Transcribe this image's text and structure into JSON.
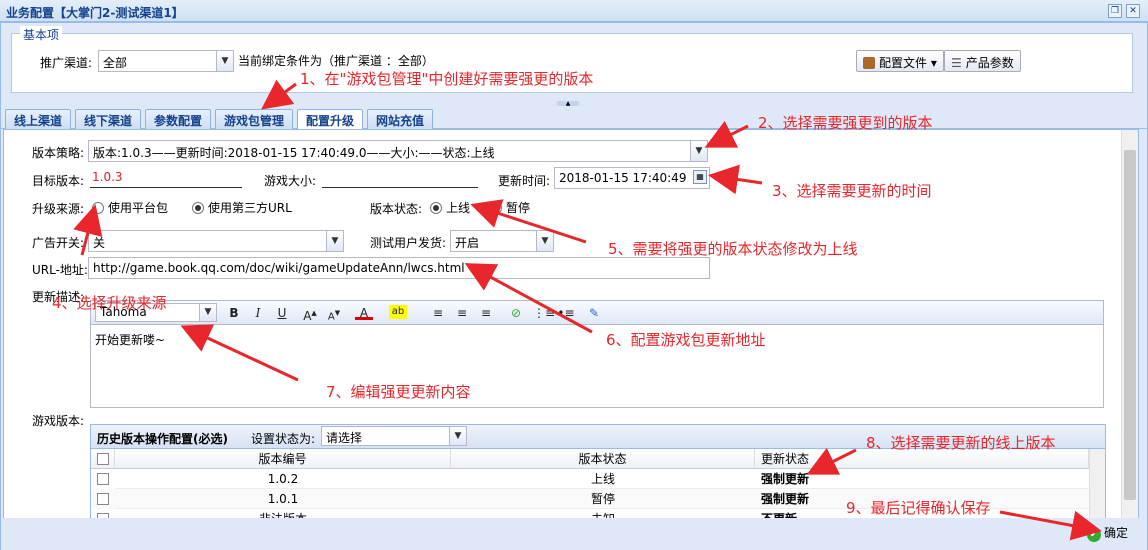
{
  "window": {
    "title": "业务配置【大掌门2-测试渠道1】"
  },
  "basic": {
    "legend": "基本项",
    "channel_label": "推广渠道:",
    "channel_value": "全部",
    "binding_text": "当前绑定条件为（推广渠道 ：全部）",
    "config_file_btn": "配置文件",
    "product_params_btn": "产品参数"
  },
  "tabs": [
    "线上渠道",
    "线下渠道",
    "参数配置",
    "游戏包管理",
    "配置升级",
    "网站充值"
  ],
  "form": {
    "strategy_label": "版本策略:",
    "strategy_value": "版本:1.0.3——更新时间:2018-01-15 17:40:49.0——大小:——状态:上线",
    "target_label": "目标版本:",
    "target_value": "1.0.3",
    "size_label": "游戏大小:",
    "size_value": "",
    "update_time_label": "更新时间:",
    "update_time_value": "2018-01-15 17:40:49",
    "source_label": "升级来源:",
    "source_opt1": "使用平台包",
    "source_opt2": "使用第三方URL",
    "status_label": "版本状态:",
    "status_opt1": "上线",
    "status_opt2": "暂停",
    "ad_label": "广告开关:",
    "ad_value": "关",
    "test_label": "测试用户发货:",
    "test_value": "开启",
    "url_label": "URL-地址:",
    "url_value": "http://game.book.qq.com/doc/wiki/gameUpdateAnn/lwcs.html",
    "desc_label": "更新描述:",
    "font_value": "Tahoma",
    "desc_text": "开始更新喽~",
    "game_ver_label": "游戏版本:"
  },
  "grid": {
    "title": "历史版本操作配置(必选)",
    "set_status_label": "设置状态为:",
    "set_status_value": "请选择",
    "headers": [
      "版本编号",
      "版本状态",
      "更新状态"
    ],
    "rows": [
      {
        "ver": "1.0.2",
        "status": "上线",
        "update": "强制更新"
      },
      {
        "ver": "1.0.1",
        "status": "暂停",
        "update": "强制更新"
      },
      {
        "ver": "非法版本",
        "status": "未知",
        "update": "不更新"
      }
    ]
  },
  "footer": {
    "confirm": "确定"
  },
  "annotations": {
    "a1": "1、在\"游戏包管理\"中创建好需要强更的版本",
    "a2": "2、选择需要强更到的版本",
    "a3": "3、选择需要更新的时间",
    "a4": "4、选择升级来源",
    "a5": "5、需要将强更的版本状态修改为上线",
    "a6": "6、配置游戏包更新地址",
    "a7": "7、编辑强更更新内容",
    "a8": "8、选择需要更新的线上版本",
    "a9": "9、最后记得确认保存"
  },
  "colors": {
    "annotation": "#e8262b",
    "header": "#15428b",
    "border": "#99bbe8"
  }
}
